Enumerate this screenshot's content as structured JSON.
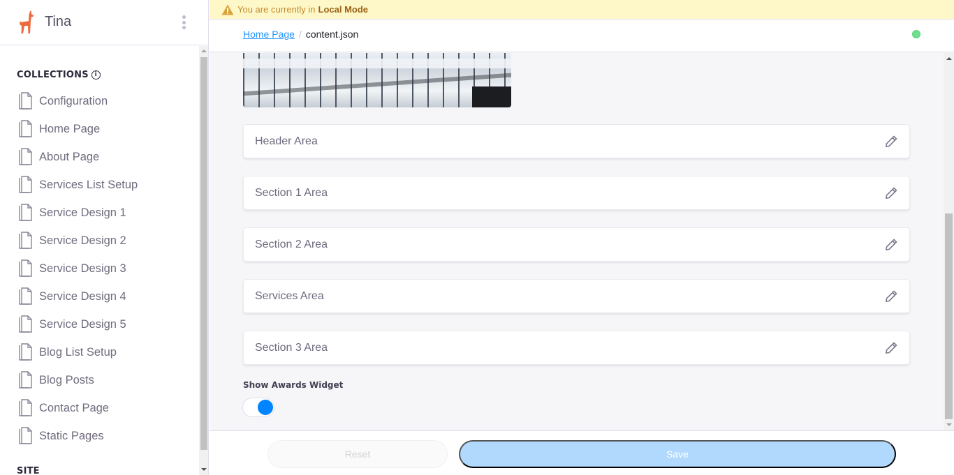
{
  "app": {
    "brand": "Tina"
  },
  "sidebar": {
    "collections_title": "COLLECTIONS",
    "site_title": "SITE",
    "items": [
      {
        "label": "Configuration",
        "icon": "document-icon"
      },
      {
        "label": "Home Page",
        "icon": "document-icon"
      },
      {
        "label": "About Page",
        "icon": "document-icon"
      },
      {
        "label": "Services List Setup",
        "icon": "document-icon"
      },
      {
        "label": "Service Design 1",
        "icon": "document-icon"
      },
      {
        "label": "Service Design 2",
        "icon": "document-icon"
      },
      {
        "label": "Service Design 3",
        "icon": "document-icon"
      },
      {
        "label": "Service Design 4",
        "icon": "document-icon"
      },
      {
        "label": "Service Design 5",
        "icon": "document-icon"
      },
      {
        "label": "Blog List Setup",
        "icon": "document-icon"
      },
      {
        "label": "Blog Posts",
        "icon": "document-icon"
      },
      {
        "label": "Contact Page",
        "icon": "document-icon"
      },
      {
        "label": "Static Pages",
        "icon": "document-icon"
      }
    ]
  },
  "banner": {
    "text": "You are currently in",
    "mode": "Local Mode",
    "icon": "warning-icon"
  },
  "breadcrumb": {
    "parent": "Home Page",
    "separator": "/",
    "current": "content.json"
  },
  "status": {
    "color": "#6fe08e",
    "state": "connected"
  },
  "form": {
    "groups": [
      {
        "label": "Header Area"
      },
      {
        "label": "Section 1 Area"
      },
      {
        "label": "Section 2 Area"
      },
      {
        "label": "Services Area"
      },
      {
        "label": "Section 3 Area"
      }
    ],
    "toggle": {
      "label": "Show Awards Widget",
      "value": true
    }
  },
  "footer": {
    "reset_label": "Reset",
    "save_label": "Save"
  },
  "colors": {
    "accent": "#0084ff",
    "brand": "#ec4815",
    "banner_bg": "#fef8c9"
  }
}
